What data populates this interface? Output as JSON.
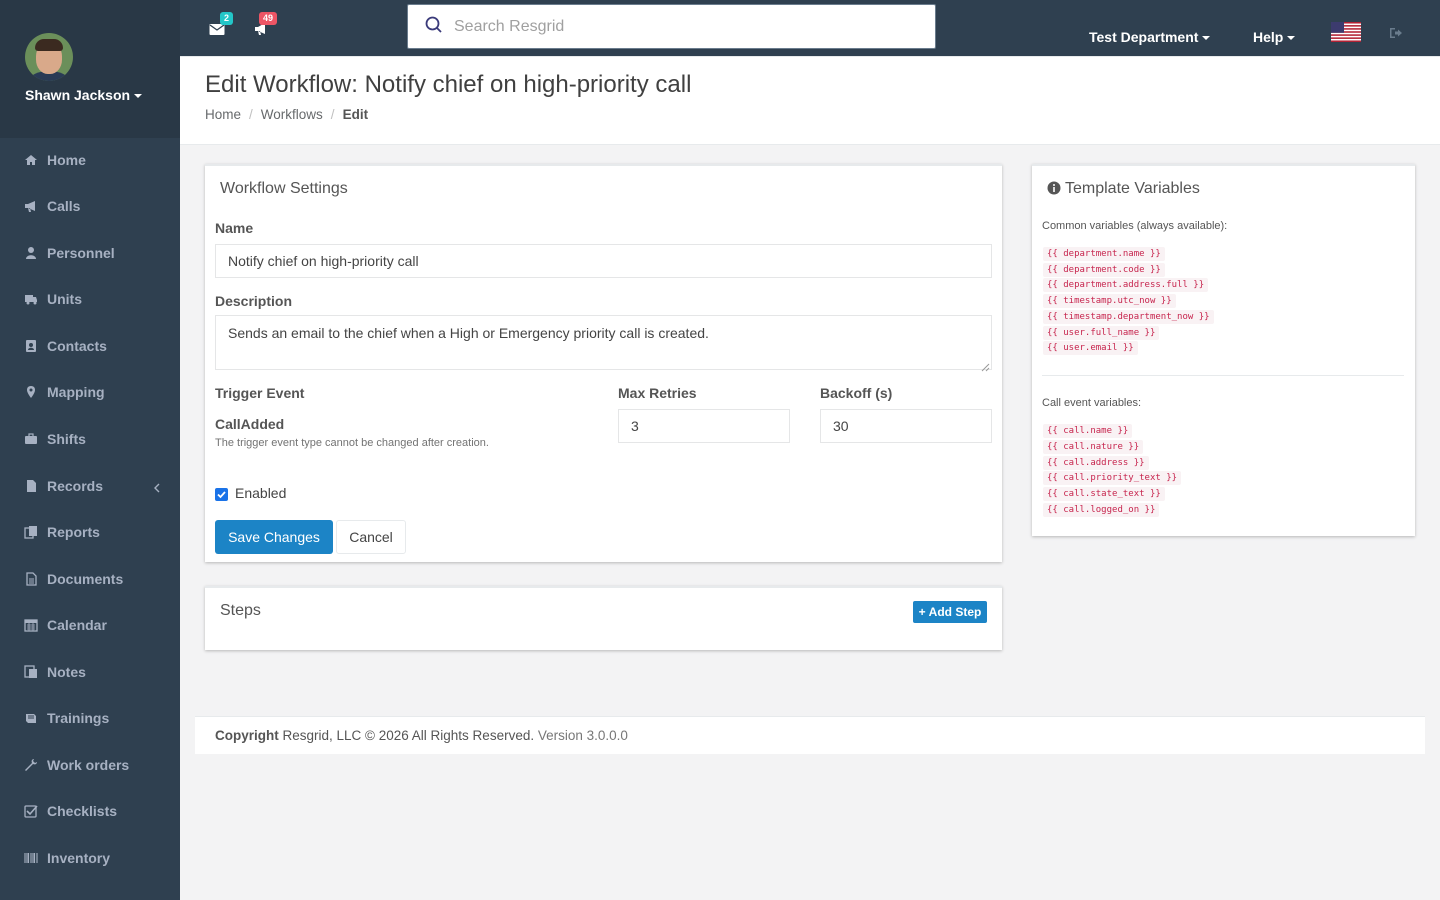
{
  "user": {
    "name": "Shawn Jackson"
  },
  "sidebar": {
    "items": [
      {
        "label": "Home",
        "icon": "home-icon"
      },
      {
        "label": "Calls",
        "icon": "bullhorn-icon"
      },
      {
        "label": "Personnel",
        "icon": "user-icon"
      },
      {
        "label": "Units",
        "icon": "truck-icon"
      },
      {
        "label": "Contacts",
        "icon": "address-book-icon"
      },
      {
        "label": "Mapping",
        "icon": "map-marker-icon"
      },
      {
        "label": "Shifts",
        "icon": "briefcase-icon"
      },
      {
        "label": "Records",
        "icon": "file-icon"
      },
      {
        "label": "Reports",
        "icon": "copy-icon"
      },
      {
        "label": "Documents",
        "icon": "file-text-icon"
      },
      {
        "label": "Calendar",
        "icon": "calendar-icon"
      },
      {
        "label": "Notes",
        "icon": "notes-icon"
      },
      {
        "label": "Trainings",
        "icon": "graduation-icon"
      },
      {
        "label": "Work orders",
        "icon": "wrench-icon"
      },
      {
        "label": "Checklists",
        "icon": "checklist-icon"
      },
      {
        "label": "Inventory",
        "icon": "barcode-icon"
      }
    ]
  },
  "topbar": {
    "messages_count": "2",
    "alerts_count": "49",
    "search_placeholder": "Search Resgrid",
    "department": "Test Department",
    "help": "Help",
    "colors": {
      "bg": "#2f4050",
      "messages_badge": "#23c6c8",
      "alerts_badge": "#ed5565"
    }
  },
  "page": {
    "title": "Edit Workflow: Notify chief on high-priority call",
    "breadcrumb": [
      "Home",
      "Workflows",
      "Edit"
    ]
  },
  "settings": {
    "title": "Workflow Settings",
    "name_label": "Name",
    "name_value": "Notify chief on high-priority call",
    "description_label": "Description",
    "description_value": "Sends an email to the chief when a High or Emergency priority call is created.",
    "trigger_label": "Trigger Event",
    "trigger_value": "CallAdded",
    "trigger_help": "The trigger event type cannot be changed after creation.",
    "max_retries_label": "Max Retries",
    "max_retries_value": "3",
    "backoff_label": "Backoff (s)",
    "backoff_value": "30",
    "enabled_label": "Enabled",
    "enabled": true,
    "save_label": "Save Changes",
    "cancel_label": "Cancel"
  },
  "steps": {
    "title": "Steps",
    "add_label": "Add Step"
  },
  "template_vars": {
    "title": "Template Variables",
    "common_caption": "Common variables (always available):",
    "common": [
      "{{ department.name }}",
      "{{ department.code }}",
      "{{ department.address.full }}",
      "{{ timestamp.utc_now }}",
      "{{ timestamp.department_now }}",
      "{{ user.full_name }}",
      "{{ user.email }}"
    ],
    "call_caption": "Call event variables:",
    "call": [
      "{{ call.name }}",
      "{{ call.nature }}",
      "{{ call.address }}",
      "{{ call.priority_text }}",
      "{{ call.state_text }}",
      "{{ call.logged_on }}"
    ]
  },
  "footer": {
    "copyright": "Copyright",
    "company": "Resgrid, LLC © 2026 All Rights Reserved.",
    "version": "Version 3.0.0.0"
  },
  "colors": {
    "primary": "#1c84c6",
    "code_text": "#c7254e",
    "sidebar_bg": "#2f4050"
  }
}
